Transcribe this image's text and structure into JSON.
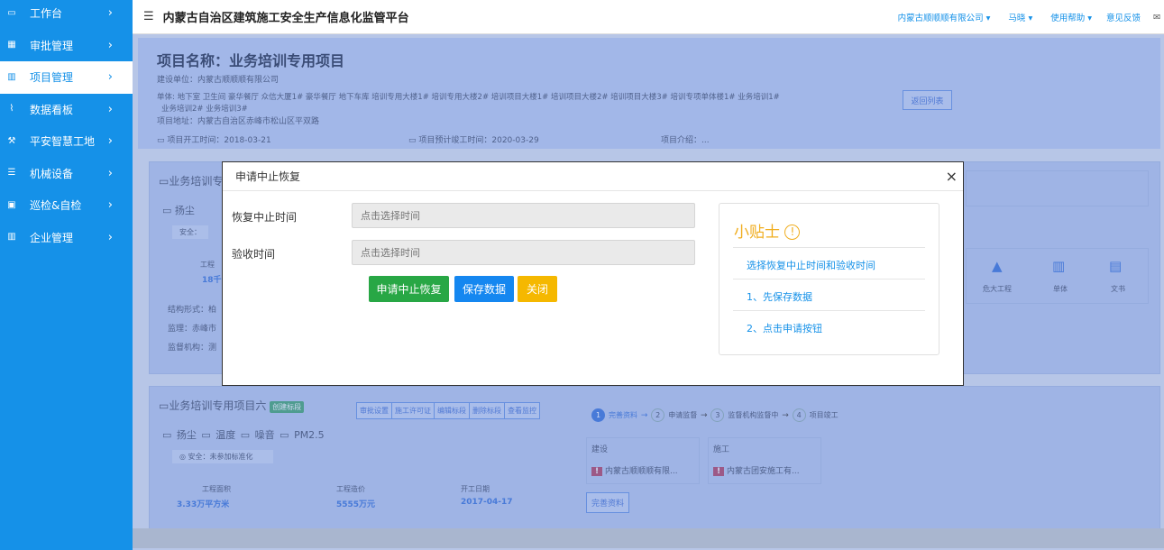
{
  "sidebar": {
    "items": [
      {
        "label": "工作台",
        "icon": "monitor-icon",
        "active": false
      },
      {
        "label": "审批管理",
        "icon": "table-icon",
        "active": false
      },
      {
        "label": "项目管理",
        "icon": "building-icon",
        "active": true
      },
      {
        "label": "数据看板",
        "icon": "chart-icon",
        "active": false
      },
      {
        "label": "平安智慧工地",
        "icon": "hammer-icon",
        "active": false
      },
      {
        "label": "机械设备",
        "icon": "machine-icon",
        "active": false
      },
      {
        "label": "巡检&自检",
        "icon": "clipboard-icon",
        "active": false
      },
      {
        "label": "企业管理",
        "icon": "company-icon",
        "active": false
      }
    ]
  },
  "topbar": {
    "title": "内蒙古自治区建筑施工安全生产信息化监管平台",
    "company": "内蒙古顺顺顺有限公司 ▾",
    "user": "马晓 ▾",
    "help": "使用帮助 ▾",
    "feedback": "意见反馈"
  },
  "project": {
    "title": "项目名称：业务培训专用项目",
    "builder": "建设单位：内蒙古顺顺顺有限公司",
    "units_line1": "单体:   地下室  卫生间  豪华餐厅  众信大厦1#  豪华餐厅  地下车库  培训专用大楼1#  培训专用大楼2#  培训项目大楼1#  培训项目大楼2#  培训项目大楼3#  培训专项单体楼1#  业务培训1#",
    "units_line2": "业务培训2#  业务培训3#",
    "address": "项目地址：内蒙古自治区赤峰市松山区平双路",
    "start": "项目开工时间：2018-03-21",
    "end": "项目预计竣工时间：2020-03-29",
    "intro": "项目介绍：...",
    "return_btn": "返回列表"
  },
  "bg_card1": {
    "title": "业务培训专",
    "sensor": "扬尘",
    "safety": "安全：",
    "area_label": "工程",
    "area_val": "18千",
    "struct": "结构形式：柏",
    "supervisor": "监理：赤峰市",
    "agency": "监督机构：测",
    "icons": [
      "危大工程",
      "单体",
      "文书"
    ]
  },
  "bg_card2": {
    "title": "业务培训专用项目六",
    "badge": "创建标段",
    "buttons": [
      "审批设置",
      "施工许可证",
      "编辑标段",
      "删除标段",
      "查看监控"
    ],
    "sensors": [
      "扬尘",
      "温度",
      "噪音",
      "PM2.5"
    ],
    "safety": "安全：未参加标准化",
    "stats": [
      {
        "label": "工程面积",
        "value": "3.33万平方米"
      },
      {
        "label": "工程造价",
        "value": "5555万元"
      },
      {
        "label": "开工日期",
        "value": "2017-04-17"
      }
    ],
    "steps": [
      "完善资料",
      "申请监督",
      "监督机构监督中",
      "项目竣工"
    ],
    "col1_head": "建设",
    "col1_val": "内蒙古顺顺顺有限...",
    "col2_head": "施工",
    "col2_val": "内蒙古团安施工有...",
    "complete_btn": "完善资料"
  },
  "modal": {
    "title": "申请中止恢复",
    "close": "×",
    "field1_label": "恢复中止时间",
    "field1_placeholder": "点击选择时间",
    "field2_label": "验收时间",
    "field2_placeholder": "点击选择时间",
    "btn_apply": "申请中止恢复",
    "btn_save": "保存数据",
    "btn_close": "关闭",
    "tips_title": "小贴士",
    "tip1": "选择恢复中止时间和验收时间",
    "tip2": "1、先保存数据",
    "tip3": "2、点击申请按钮"
  },
  "colors": {
    "sidebar": "#1591e8",
    "green": "#28a745",
    "blue": "#1587f0",
    "yellow": "#f5b800"
  }
}
